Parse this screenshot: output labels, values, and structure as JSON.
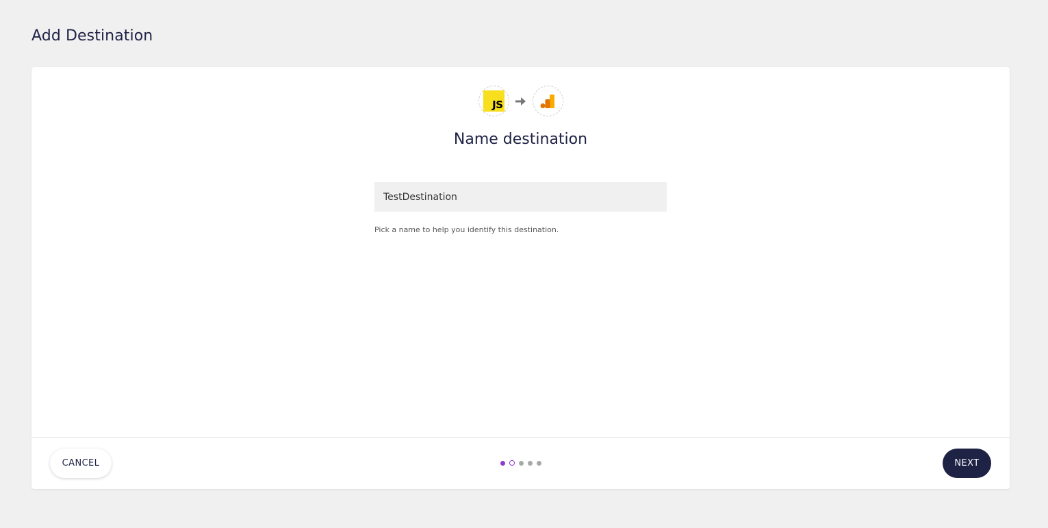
{
  "page": {
    "title": "Add Destination"
  },
  "header": {
    "source_icon": "javascript-logo-icon",
    "source_icon_text": "JS",
    "arrow_icon": "arrow-right-icon",
    "destination_icon": "google-analytics-icon"
  },
  "form": {
    "heading": "Name destination",
    "name_value": "TestDestination",
    "help_text": "Pick a name to help you identify this destination."
  },
  "footer": {
    "cancel_label": "CANCEL",
    "next_label": "NEXT",
    "steps": [
      "done",
      "current",
      "todo",
      "todo",
      "todo"
    ]
  },
  "colors": {
    "primary": "#1e2245",
    "accent": "#8e3bd1",
    "js_yellow": "#f7df1e",
    "background": "#f0f0f0"
  }
}
